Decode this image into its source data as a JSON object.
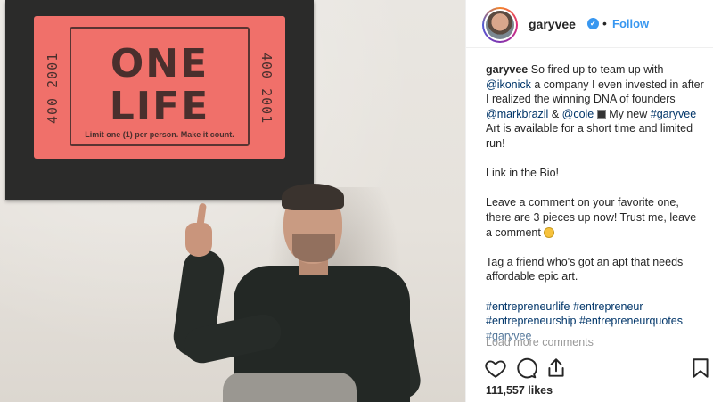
{
  "post": {
    "username": "garyvee",
    "follow_label": "Follow",
    "separator": "•",
    "verified_mark": "✓",
    "likes": "111,557 likes",
    "load_more": "Load more comments"
  },
  "artwork": {
    "line1": "ONE",
    "line2": "LIFE",
    "serial": "400 2001",
    "fine_print": "Limit one (1) per person. Make it count."
  },
  "caption": {
    "author": "garyvee",
    "p1_a": " So fired up to team up with ",
    "p1_mention1": "@ikonick",
    "p1_b": " a company I even invested in after I realized the winning DNA of founders ",
    "p1_mention2": "@markbrazil",
    "p1_c": " & ",
    "p1_mention3": "@cole",
    "p1_d": " My new ",
    "p1_hashtag": "#garyvee",
    "p1_e": " Art is available for a short time and limited run!",
    "p2": "Link in the Bio!",
    "p3": "Leave a comment on your favorite one, there are 3 pieces up now! Trust me, leave a comment ",
    "p4": "Tag a friend who's got an apt that needs affordable epic art.",
    "hashtags": [
      "#entrepreneurlife",
      "#entrepreneur",
      "#entrepreneurship",
      "#entrepreneurquotes",
      "#garyvee"
    ]
  },
  "icons": {
    "like": "heart-icon",
    "comment": "comment-icon",
    "share": "share-icon",
    "save": "bookmark-icon"
  },
  "colors": {
    "link": "#003569",
    "follow": "#3897f0",
    "ticket": "#f0706a"
  }
}
